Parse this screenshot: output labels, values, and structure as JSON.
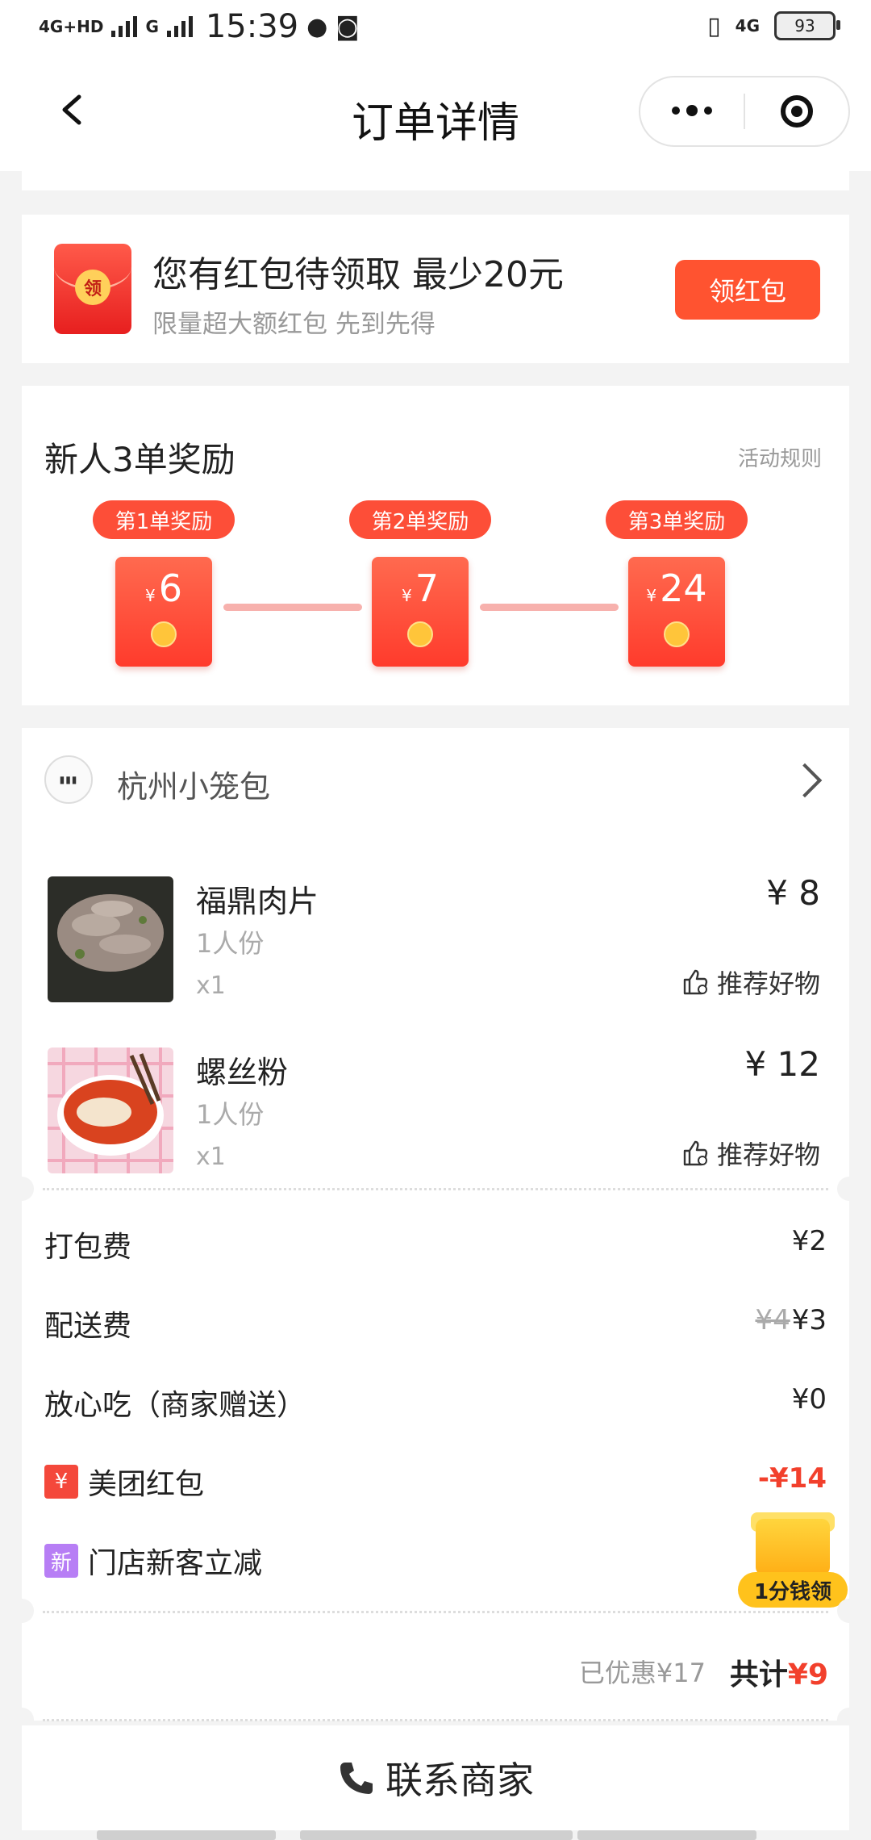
{
  "status_bar": {
    "network_left": "4G+HD",
    "network_g": "G",
    "time": "15:39",
    "network_right": "4G",
    "battery": "93"
  },
  "nav": {
    "title": "订单详情"
  },
  "banner": {
    "icon_char": "领",
    "title": "您有红包待领取 最少20元",
    "subtitle": "限量超大额红包 先到先得",
    "button": "领红包"
  },
  "rewards": {
    "title": "新人3单奖励",
    "rule_link": "活动规则",
    "currency": "¥",
    "items": [
      {
        "tag": "第1单奖励",
        "value": "6"
      },
      {
        "tag": "第2单奖励",
        "value": "7"
      },
      {
        "tag": "第3单奖励",
        "value": "24"
      }
    ]
  },
  "order": {
    "shop_logo_text": "▮▮▮",
    "shop_name": "杭州小笼包",
    "items": [
      {
        "name": "福鼎肉片",
        "spec": "1人份",
        "qty": "x1",
        "price": "¥ 8",
        "recommend": "推荐好物"
      },
      {
        "name": "螺丝粉",
        "spec": "1人份",
        "qty": "x1",
        "price": "¥ 12",
        "recommend": "推荐好物"
      }
    ],
    "fees": [
      {
        "label": "打包费",
        "value": "¥2"
      },
      {
        "label": "配送费",
        "original": "¥4",
        "value": "¥3"
      },
      {
        "label": "放心吃（商家赠送）",
        "value": "¥0"
      },
      {
        "badge": "¥",
        "label": "美团红包",
        "value": "-¥14"
      },
      {
        "badge": "新",
        "label": "门店新客立减",
        "value": ""
      }
    ],
    "badge_colors": {
      "hongbao": "#f4483b",
      "new": "#b77ef5"
    },
    "gift_label": "1分钱领",
    "saved": "已优惠¥17",
    "total_label": "共计",
    "total_value": "¥9"
  },
  "contact": {
    "label": "联系商家"
  }
}
